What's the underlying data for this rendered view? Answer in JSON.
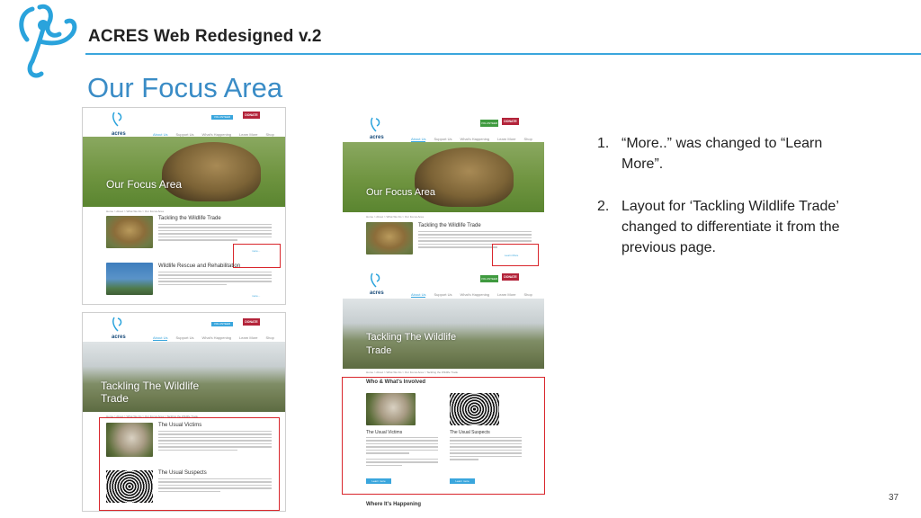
{
  "header": {
    "title": "ACRES Web Redesigned v.2"
  },
  "page_title": "Our Focus Area",
  "page_number": "37",
  "notes": [
    {
      "num": "1.",
      "text": "“More..” was changed to “Learn More”."
    },
    {
      "num": "2.",
      "text": "Layout for ‘Tackling Wildlife Trade’ changed to differentiate it from the previous page."
    }
  ],
  "mockup": {
    "brand": "acres",
    "nav": [
      "About Us",
      "Support Us",
      "What's Happening",
      "Learn More",
      "Shop"
    ],
    "volunteer_label": "VOLUNTEER",
    "donate_label": "DONATE",
    "donate_big": "DONATE",
    "volunteer_green": "VOLUNTEER WITH ACRES",
    "focus_title": "Our Focus Area",
    "trade_title_1": "Tackling The Wildlife",
    "trade_title_2": "Trade",
    "crumb_focus": "Home > About > What We Do > Our Focus Area",
    "crumb_trade": "Home > About > What We Do > Our Focus Area > Tackling the Wildlife Trade",
    "section_trade": "Tackling the Wildlife Trade",
    "section_rescue": "Wildlife Rescue and Rehabilitation",
    "more_short": "more...",
    "more_long": "Learn More",
    "victims": "The Usual Victims",
    "suspects": "The Usual Suspects",
    "who_heading": "Who & What's Involved",
    "where_heading": "Where It's Happening",
    "learn_btn": "Learn more"
  },
  "colors": {
    "accent": "#3aa6dd",
    "title_blue": "#3a8cc6",
    "highlight_red": "#d9262c",
    "donate": "#b3243a"
  }
}
